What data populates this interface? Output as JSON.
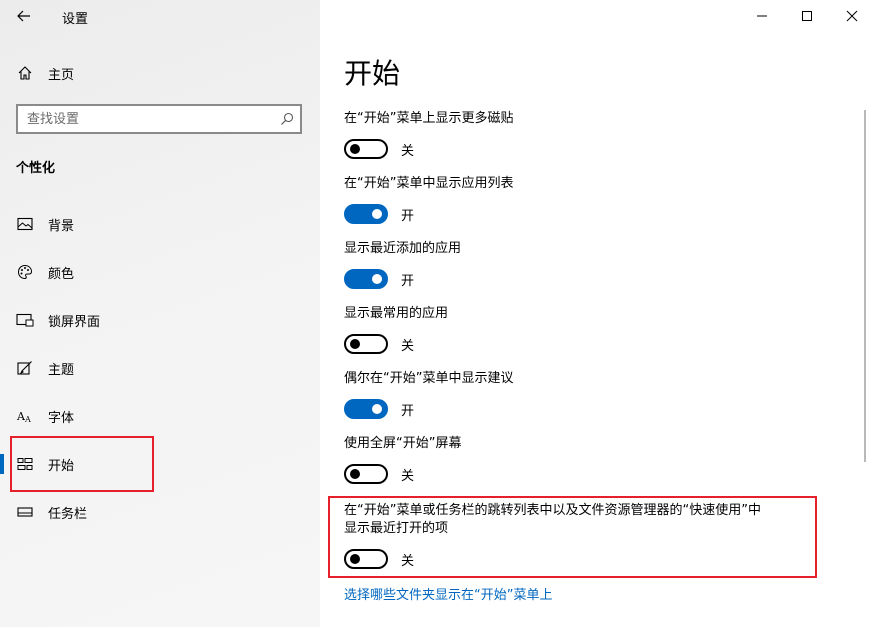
{
  "window": {
    "title": "设置",
    "icons": [
      "back-arrow-icon",
      "minimize-icon",
      "maximize-icon",
      "close-icon"
    ]
  },
  "sidebar": {
    "home_label": "主页",
    "search_placeholder": "查找设置",
    "section_title": "个性化",
    "items": [
      {
        "label": "背景",
        "icon": "picture-icon",
        "selected": false
      },
      {
        "label": "颜色",
        "icon": "palette-icon",
        "selected": false
      },
      {
        "label": "锁屏界面",
        "icon": "lock-screen-icon",
        "selected": false
      },
      {
        "label": "主题",
        "icon": "theme-brush-icon",
        "selected": false
      },
      {
        "label": "字体",
        "icon": "font-icon",
        "selected": false
      },
      {
        "label": "开始",
        "icon": "start-tiles-icon",
        "selected": true
      },
      {
        "label": "任务栏",
        "icon": "taskbar-icon",
        "selected": false
      }
    ]
  },
  "main": {
    "title": "开始",
    "settings": [
      {
        "label": "在“开始”菜单上显示更多磁贴",
        "state": "关",
        "on": false
      },
      {
        "label": "在“开始”菜单中显示应用列表",
        "state": "开",
        "on": true
      },
      {
        "label": "显示最近添加的应用",
        "state": "开",
        "on": true
      },
      {
        "label": "显示最常用的应用",
        "state": "关",
        "on": false
      },
      {
        "label": "偶尔在“开始”菜单中显示建议",
        "state": "开",
        "on": true
      },
      {
        "label": "使用全屏“开始”屏幕",
        "state": "关",
        "on": false
      },
      {
        "label_line1": "在“开始”菜单或任务栏的跳转列表中以及文件资源管理器的“快速使用”中",
        "label_line2": "显示最近打开的项",
        "state": "关",
        "on": false
      }
    ],
    "link": "选择哪些文件夹显示在“开始”菜单上"
  },
  "colors": {
    "accent": "#0067c0",
    "highlight_box": "#e5202a"
  }
}
